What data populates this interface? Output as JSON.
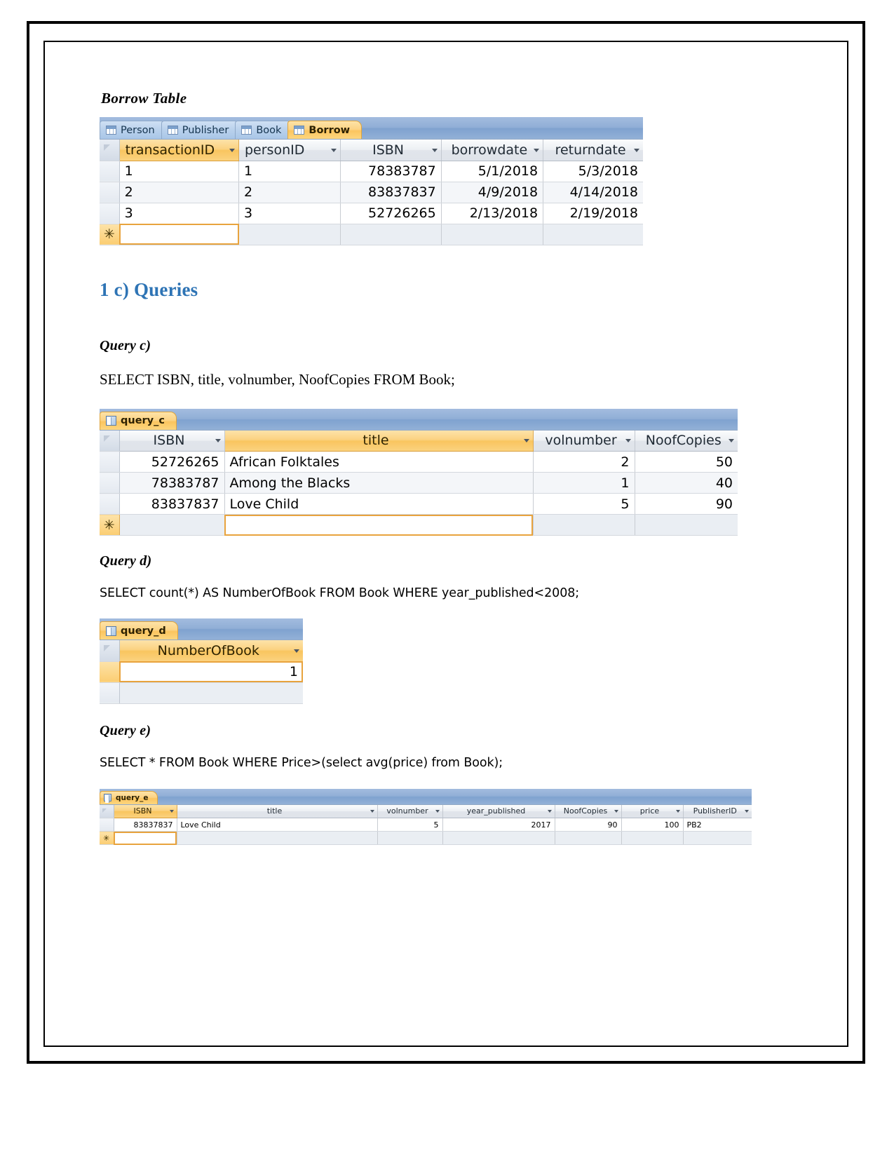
{
  "document": {
    "borrow_heading": "Borrow Table",
    "queries_heading": "1 c) Queries",
    "query_c_heading": "Query c)",
    "query_c_sql": "SELECT ISBN, title, volnumber, NoofCopies FROM Book;",
    "query_d_heading": "Query d)",
    "query_d_sql": "SELECT count(*) AS NumberOfBook FROM Book WHERE year_published<2008;",
    "query_e_heading": "Query e)",
    "query_e_sql": "SELECT * FROM Book WHERE Price>(select avg(price) from Book);"
  },
  "borrow_table": {
    "tabs": [
      {
        "label": "Person",
        "active": false,
        "icon": "table-icon"
      },
      {
        "label": "Publisher",
        "active": false,
        "icon": "table-icon"
      },
      {
        "label": "Book",
        "active": false,
        "icon": "table-icon"
      },
      {
        "label": "Borrow",
        "active": true,
        "icon": "table-icon"
      }
    ],
    "columns": [
      {
        "name": "transactionID",
        "selected": true
      },
      {
        "name": "personID",
        "selected": false
      },
      {
        "name": "ISBN",
        "selected": false
      },
      {
        "name": "borrowdate",
        "selected": false
      },
      {
        "name": "returndate",
        "selected": false
      }
    ],
    "rows": [
      [
        "1",
        "1",
        "78383787",
        "5/1/2018",
        "5/3/2018"
      ],
      [
        "2",
        "2",
        "83837837",
        "4/9/2018",
        "4/14/2018"
      ],
      [
        "3",
        "3",
        "52726265",
        "2/13/2018",
        "2/19/2018"
      ]
    ],
    "new_record_marker": "✳"
  },
  "query_c": {
    "tab_label": "query_c",
    "columns": [
      {
        "name": "ISBN",
        "selected": false
      },
      {
        "name": "title",
        "selected": true
      },
      {
        "name": "volnumber",
        "selected": false
      },
      {
        "name": "NoofCopies",
        "selected": false
      }
    ],
    "rows": [
      [
        "52726265",
        "African Folktales",
        "2",
        "50"
      ],
      [
        "78383787",
        "Among the Blacks",
        "1",
        "40"
      ],
      [
        "83837837",
        "Love Child",
        "5",
        "90"
      ]
    ],
    "new_record_marker": "✳"
  },
  "query_d": {
    "tab_label": "query_d",
    "columns": [
      {
        "name": "NumberOfBook",
        "selected": true
      }
    ],
    "rows": [
      [
        "1"
      ]
    ]
  },
  "query_e": {
    "tab_label": "query_e",
    "columns": [
      {
        "name": "ISBN",
        "selected": true
      },
      {
        "name": "title",
        "selected": false
      },
      {
        "name": "volnumber",
        "selected": false
      },
      {
        "name": "year_published",
        "selected": false
      },
      {
        "name": "NoofCopies",
        "selected": false
      },
      {
        "name": "price",
        "selected": false
      },
      {
        "name": "PublisherID",
        "selected": false
      }
    ],
    "rows": [
      [
        "83837837",
        "Love Child",
        "5",
        "2017",
        "90",
        "100",
        "PB2"
      ]
    ],
    "new_record_marker": "✳"
  },
  "colors": {
    "heading_blue": "#2e74b5",
    "access_tab_active": "#fbc55f",
    "access_tab_inactive": "#b9d1ec",
    "access_titlebar": "#8fafd6"
  }
}
